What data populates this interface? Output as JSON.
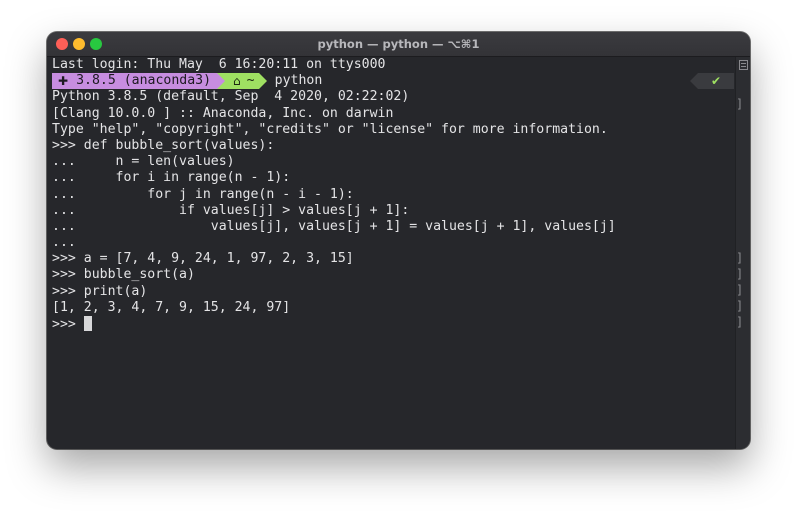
{
  "window": {
    "title": "python — python — ⌥⌘1"
  },
  "terminal": {
    "last_login": "Last login: Thu May  6 16:20:11 on ttys000",
    "prompt": {
      "env_label": "3.8.5 (anaconda3)",
      "dir_label": "~",
      "command": "python",
      "status": "✔"
    },
    "lines": [
      "Python 3.8.5 (default, Sep  4 2020, 02:22:02)",
      "[Clang 10.0.0 ] :: Anaconda, Inc. on darwin",
      "Type \"help\", \"copyright\", \"credits\" or \"license\" for more information.",
      ">>> def bubble_sort(values):",
      "...     n = len(values)",
      "...     for i in range(n - 1):",
      "...         for j in range(n - i - 1):",
      "...             if values[j] > values[j + 1]:",
      "...                 values[j], values[j + 1] = values[j + 1], values[j]",
      "...",
      ">>> a = [7, 4, 9, 24, 1, 97, 2, 3, 15]",
      ">>> bubble_sort(a)",
      ">>> print(a)",
      "[1, 2, 3, 4, 7, 9, 15, 24, 97]"
    ],
    "final_prompt": ">>> "
  }
}
